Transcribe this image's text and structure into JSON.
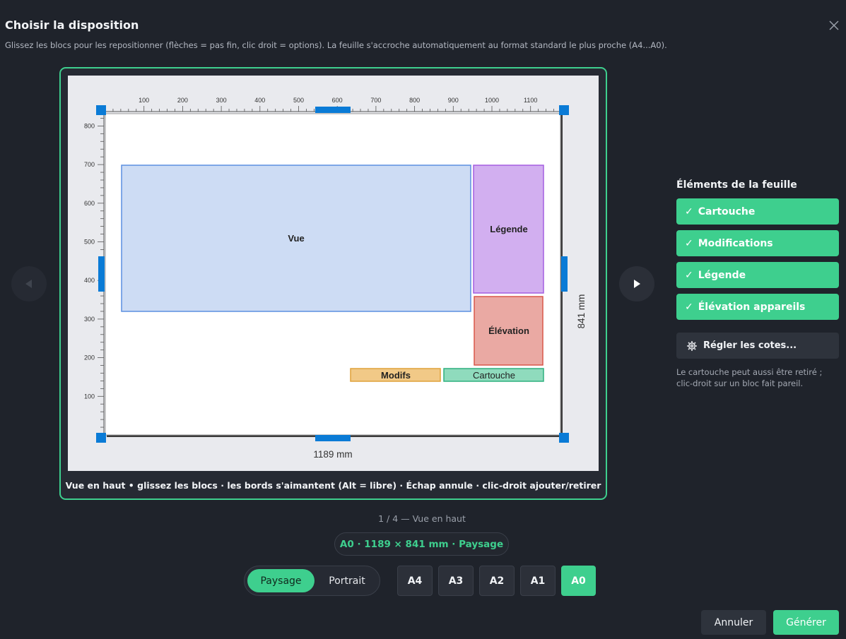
{
  "dialog": {
    "title": "Choisir la disposition",
    "subtitle": "Glissez les blocs pour les repositionner (flèches = pas fin, clic droit = options). La feuille s'accroche automatiquement au format standard le plus proche (A4...A0)."
  },
  "preview": {
    "caption": "Vue en haut  •  glissez les blocs · les bords s'aimantent (Alt = libre) · Échap annule · clic-droit ajouter/retirer",
    "width_label": "1189 mm",
    "height_label": "841 mm",
    "ruler_x_ticks": [
      "100",
      "200",
      "300",
      "400",
      "500",
      "600",
      "700",
      "800",
      "900",
      "1000",
      "1100"
    ],
    "ruler_y_ticks": [
      "800",
      "700",
      "600",
      "500",
      "400",
      "300",
      "200",
      "100"
    ],
    "blocks": {
      "vue": "Vue",
      "legende": "Légende",
      "elevation": "Élévation",
      "modifs": "Modifs",
      "cartouche": "Cartouche"
    }
  },
  "pager": {
    "label": "1 / 4 — Vue en haut"
  },
  "format": {
    "summary": "A0  ·  1189 × 841 mm  ·  Paysage"
  },
  "orientation": {
    "landscape": "Paysage",
    "portrait": "Portrait",
    "selected": "Paysage"
  },
  "sizes": [
    {
      "label": "A4"
    },
    {
      "label": "A3"
    },
    {
      "label": "A2"
    },
    {
      "label": "A1"
    },
    {
      "label": "A0"
    }
  ],
  "sidebar": {
    "title": "Éléments de la feuille",
    "items": [
      {
        "check": "✓",
        "label": "Cartouche"
      },
      {
        "check": "✓",
        "label": "Modifications"
      },
      {
        "check": "✓",
        "label": "Légende"
      },
      {
        "check": "✓",
        "label": "Élévation appareils"
      }
    ],
    "dims_button": "Régler les cotes...",
    "hint": "Le cartouche peut aussi être retiré ; clic-droit sur un bloc fait pareil."
  },
  "footer": {
    "cancel": "Annuler",
    "generate": "Générer"
  },
  "colors": {
    "accent": "#3ecf8e",
    "handle": "#0a7bd6",
    "vue": "#cddcf4",
    "legende": "#d2aff0",
    "elevation": "#eaa9a3",
    "modifs": "#f1c987",
    "cartouche": "#8fdbbd"
  }
}
